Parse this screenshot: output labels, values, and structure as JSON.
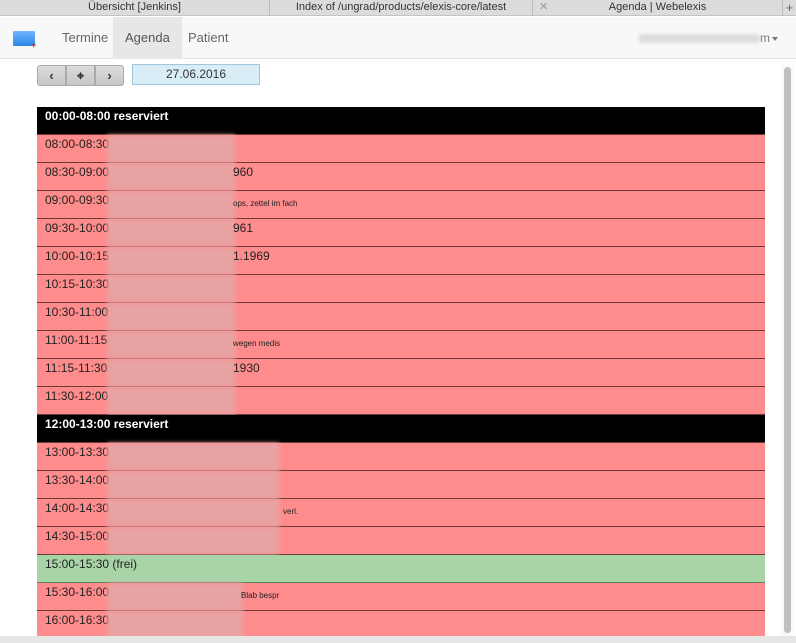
{
  "browser": {
    "tabs": [
      {
        "title": "Übersicht [Jenkins]"
      },
      {
        "title": "Index of /ungrad/products/elexis-core/latest"
      },
      {
        "title": "Agenda | Webelexis"
      }
    ],
    "new_tab": "+"
  },
  "navbar": {
    "items": [
      {
        "label": "Termine"
      },
      {
        "label": "Agenda"
      },
      {
        "label": "Patient"
      }
    ],
    "user_suffix": "m"
  },
  "toolbar": {
    "prev": "‹",
    "today": "⌖",
    "next": "›",
    "date": "27.06.2016"
  },
  "agenda": {
    "slots": [
      {
        "time": "00:00-08:00 reserviert",
        "kind": "reserved"
      },
      {
        "time": "08:00-08:30",
        "kind": "booked",
        "tail": ""
      },
      {
        "time": "08:30-09:00",
        "kind": "booked",
        "tail": "960"
      },
      {
        "time": "09:00-09:30",
        "kind": "booked",
        "tail": "ops, zettel im fach",
        "small": true
      },
      {
        "time": "09:30-10:00",
        "kind": "booked",
        "tail": "961"
      },
      {
        "time": "10:00-10:15",
        "kind": "booked",
        "tail": "1.1969"
      },
      {
        "time": "10:15-10:30",
        "kind": "booked",
        "tail": ""
      },
      {
        "time": "10:30-11:00",
        "kind": "booked",
        "tail": ""
      },
      {
        "time": "11:00-11:15",
        "kind": "booked",
        "tail": "wegen medis",
        "small": true
      },
      {
        "time": "11:15-11:30",
        "kind": "booked",
        "tail": "1930"
      },
      {
        "time": "11:30-12:00",
        "kind": "booked",
        "tail": ""
      },
      {
        "time": "12:00-13:00 reserviert",
        "kind": "reserved"
      },
      {
        "time": "13:00-13:30",
        "kind": "booked",
        "tail": ""
      },
      {
        "time": "13:30-14:00",
        "kind": "booked",
        "tail": ""
      },
      {
        "time": "14:00-14:30",
        "kind": "booked",
        "tail": "verl.",
        "small": true
      },
      {
        "time": "14:30-15:00",
        "kind": "booked",
        "tail": ""
      },
      {
        "time": "15:00-15:30 (frei)",
        "kind": "free"
      },
      {
        "time": "15:30-16:00",
        "kind": "booked",
        "tail": "Blab bespr",
        "small": true
      },
      {
        "time": "16:00-16:30",
        "kind": "booked",
        "tail": ""
      }
    ]
  },
  "colors": {
    "reserved": "#000000",
    "booked": "#ff8c8c",
    "free": "#a8d5a8",
    "date_box": "#d9edf7"
  }
}
